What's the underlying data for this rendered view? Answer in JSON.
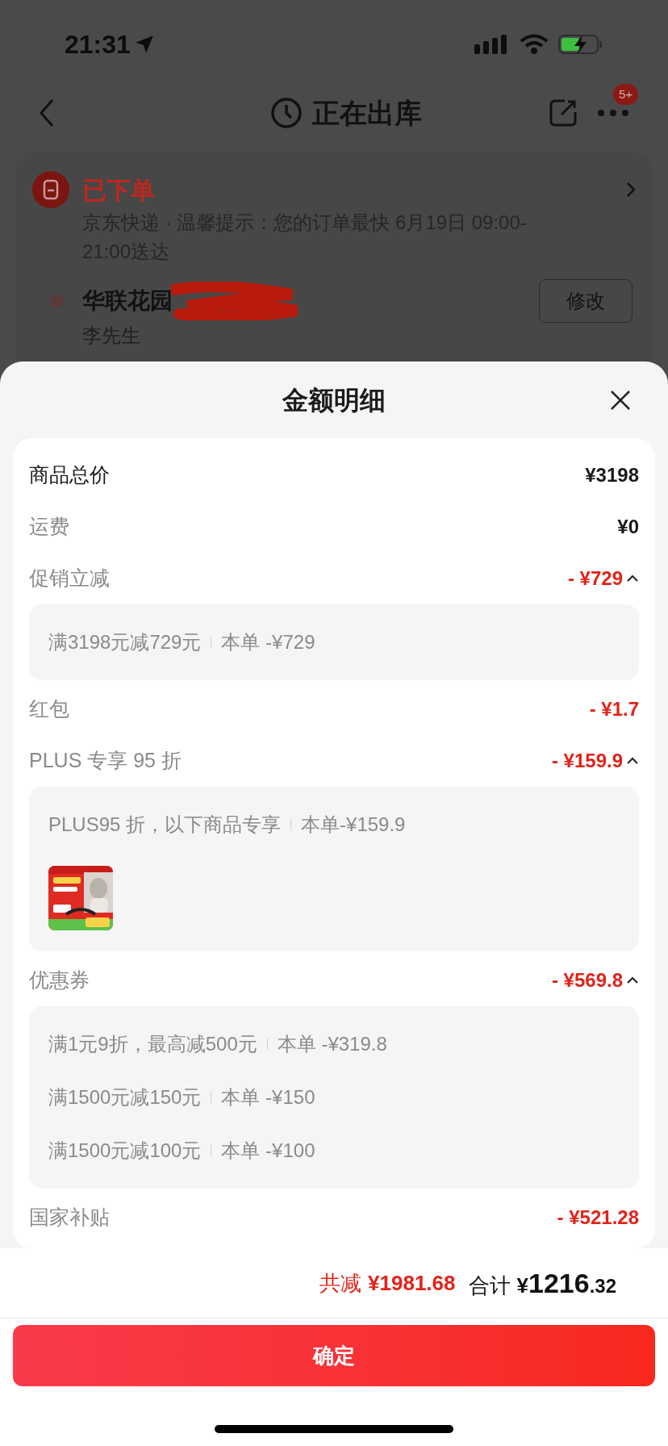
{
  "status_bar": {
    "time": "21:31"
  },
  "nav": {
    "title": "正在出库",
    "badge": "5+"
  },
  "order": {
    "status": "已下单",
    "note": "京东快递 · 温馨提示：您的订单最快 6月19日 09:00-21:00送达",
    "address": "华联花园",
    "contact": "李先生",
    "edit_button": "修改"
  },
  "sheet": {
    "title": "金额明细",
    "rows": [
      {
        "kind": "total",
        "label": "商品总价",
        "amount": "¥3198"
      },
      {
        "kind": "fee",
        "label": "运费",
        "amount": "¥0"
      },
      {
        "kind": "discount",
        "label": "促销立减",
        "amount": "- ¥729",
        "expanded": true,
        "details": [
          {
            "condition": "满3198元减729元",
            "amount": "本单 -¥729"
          }
        ]
      },
      {
        "kind": "discount",
        "label": "红包",
        "amount": "- ¥1.7"
      },
      {
        "kind": "discount",
        "label": "PLUS 专享 95 折",
        "amount": "- ¥159.9",
        "expanded": true,
        "details": [
          {
            "condition": "PLUS95 折，以下商品专享",
            "amount": "本单-¥159.9"
          }
        ]
      },
      {
        "kind": "discount",
        "label": "优惠券",
        "amount": "- ¥569.8",
        "expanded": true,
        "details": [
          {
            "condition": "满1元9折，最高减500元",
            "amount": "本单 -¥319.8"
          },
          {
            "condition": "满1500元减150元",
            "amount": "本单 -¥150"
          },
          {
            "condition": "满1500元减100元",
            "amount": "本单 -¥100"
          }
        ]
      },
      {
        "kind": "discount",
        "label": "国家补贴",
        "amount": "- ¥521.28"
      }
    ],
    "summary": {
      "saved_label": "共减",
      "saved_amount": "¥1981.68",
      "total_label": "合计",
      "currency": "¥",
      "total_integer": "1216",
      "total_decimal": ".32"
    },
    "confirm_button": "确定"
  }
}
